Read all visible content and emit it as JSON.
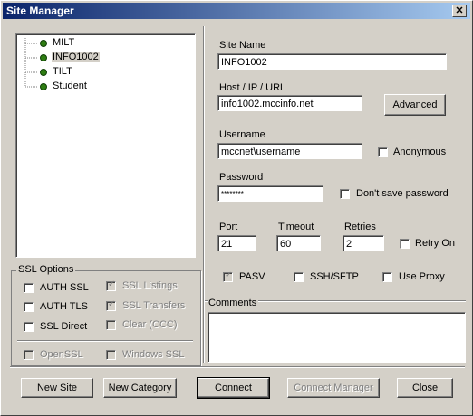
{
  "window": {
    "title": "Site Manager",
    "close_glyph": "✕"
  },
  "tree": {
    "items": [
      {
        "label": "MILT"
      },
      {
        "label": "INFO1002",
        "selected": true
      },
      {
        "label": "TILT"
      },
      {
        "label": "Student"
      }
    ]
  },
  "ssl": {
    "title": "SSL Options",
    "auth_ssl": "AUTH SSL",
    "auth_tls": "AUTH TLS",
    "ssl_direct": "SSL Direct",
    "ssl_listings": "SSL Listings",
    "ssl_transfers": "SSL Transfers",
    "clear_ccc": "Clear (CCC)",
    "openssl": "OpenSSL",
    "windows_ssl": "Windows SSL"
  },
  "form": {
    "site_name_label": "Site Name",
    "site_name_value": "INFO1002",
    "host_label": "Host / IP / URL",
    "host_value": "info1002.mccinfo.net",
    "advanced_btn": "Advanced",
    "username_label": "Username",
    "username_value": "mccnet\\username",
    "anonymous_label": "Anonymous",
    "password_label": "Password",
    "password_value": "********",
    "dont_save_label": "Don't save password",
    "port_label": "Port",
    "port_value": "21",
    "timeout_label": "Timeout",
    "timeout_value": "60",
    "retries_label": "Retries",
    "retries_value": "2",
    "retry_on_label": "Retry On",
    "pasv_label": "PASV",
    "ssh_label": "SSH/SFTP",
    "proxy_label": "Use Proxy",
    "comments_label": "Comments"
  },
  "buttons": {
    "new_site": "New Site",
    "new_category": "New Category",
    "connect": "Connect",
    "connect_manager": "Connect Manager",
    "close": "Close"
  }
}
